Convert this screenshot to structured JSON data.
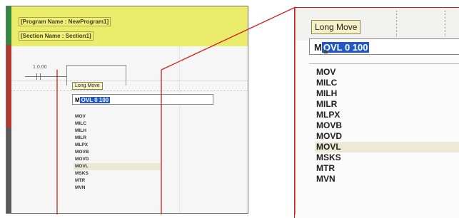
{
  "left": {
    "program_name": "[Program Name : NewProgram1]",
    "section_name": "[Section Name : Section1]",
    "contact_address": "1.0.00",
    "tooltip": "Long Move",
    "input_prefix": "M",
    "input_selected": "OVL 0 100",
    "list": [
      "MOV",
      "MILC",
      "MILH",
      "MILR",
      "MLPX",
      "MOVB",
      "MOVD",
      "MOVL",
      "MSKS",
      "MTR",
      "MVN"
    ],
    "highlight_index": 7
  },
  "zoom": {
    "tooltip": "Long Move",
    "input_prefix": "M",
    "input_selected": "OVL 0 100",
    "list": [
      "MOV",
      "MILC",
      "MILH",
      "MILR",
      "MLPX",
      "MOVB",
      "MOVD",
      "MOVL",
      "MSKS",
      "MTR",
      "MVN"
    ],
    "highlight_index": 7
  },
  "colors": {
    "callout": "#d21f1f",
    "header_band": "#ecec6c",
    "selection": "#2257c7",
    "highlight_row": "#ecead5"
  }
}
